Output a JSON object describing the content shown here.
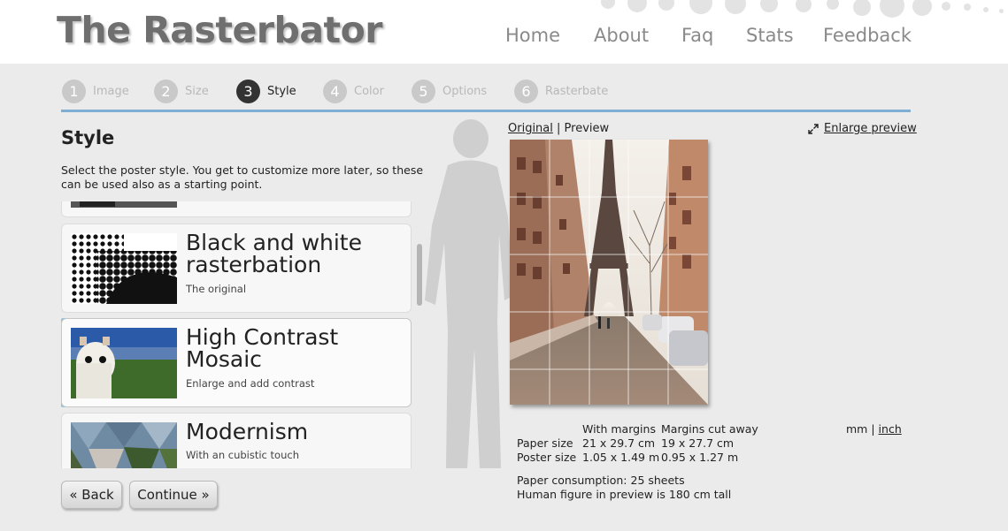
{
  "site": {
    "title": "The Rasterbator"
  },
  "nav": [
    "Home",
    "About",
    "Faq",
    "Stats",
    "Feedback"
  ],
  "steps": [
    {
      "num": "1",
      "label": "Image"
    },
    {
      "num": "2",
      "label": "Size"
    },
    {
      "num": "3",
      "label": "Style"
    },
    {
      "num": "4",
      "label": "Color"
    },
    {
      "num": "5",
      "label": "Options"
    },
    {
      "num": "6",
      "label": "Rasterbate"
    }
  ],
  "active_step": 3,
  "style_section": {
    "title": "Style",
    "description": "Select the poster style. You get to customize more later, so these can be used also as a starting point.",
    "options": [
      {
        "title": "Black and white rasterbation",
        "subtitle": "The original"
      },
      {
        "title": "High Contrast Mosaic",
        "subtitle": "Enlarge and add contrast",
        "selected": true
      },
      {
        "title": "Modernism",
        "subtitle": "With an cubistic touch"
      }
    ]
  },
  "buttons": {
    "back": "« Back",
    "continue": "Continue »"
  },
  "preview": {
    "original_link": "Original",
    "separator": "|",
    "preview_label": "Preview",
    "enlarge_icon": "expand-icon",
    "enlarge_link": "Enlarge preview"
  },
  "dimensions": {
    "col_with_margins": "With margins",
    "col_cut_away": "Margins cut away",
    "rows": [
      {
        "label": "Paper size",
        "with_margins": "21 x 29.7 cm",
        "cut_away": "19 x 27.7 cm"
      },
      {
        "label": "Poster size",
        "with_margins": "1.05 x 1.49 m",
        "cut_away": "0.95 x 1.27 m"
      }
    ],
    "unit_mm": "mm",
    "unit_sep": "|",
    "unit_inch": "inch",
    "consumption": "Paper consumption: 25 sheets",
    "human_figure": "Human figure in preview is 180 cm tall"
  },
  "colors": {
    "accent": "#7eaed2",
    "brand_text": "#6f6f6f",
    "active_step": "#333333"
  }
}
